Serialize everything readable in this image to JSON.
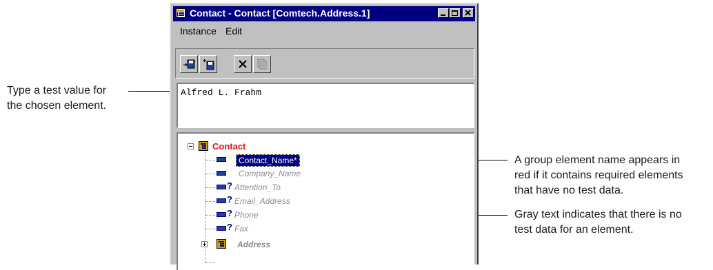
{
  "callouts": {
    "left": [
      "Type a test value for",
      "the chosen element."
    ],
    "right_top": [
      "A group element name appears in",
      "red if it contains required elements",
      "that have no test data."
    ],
    "right_bottom": [
      "Gray text indicates that there is no",
      "test data for an element."
    ]
  },
  "window": {
    "title": "Contact - Contact [Comtech.Address.1]",
    "menu": [
      "Instance",
      "Edit"
    ],
    "test_value": "Alfred L. Frahm",
    "tree": {
      "root": "Contact",
      "children": [
        {
          "label": "Contact_Name*",
          "selected": true
        },
        {
          "label": "Company_Name",
          "optional": false
        },
        {
          "label": "Attention_To",
          "optional": true
        },
        {
          "label": "Email_Address",
          "optional": true
        },
        {
          "label": "Phone",
          "optional": true
        },
        {
          "label": "Fax",
          "optional": true
        }
      ],
      "collapsed_group": "Address"
    }
  },
  "colors": {
    "title_bar": "#000080",
    "required_group": "#e0101c",
    "selection": "#000080",
    "no_data_text": "#8c8c8c"
  }
}
